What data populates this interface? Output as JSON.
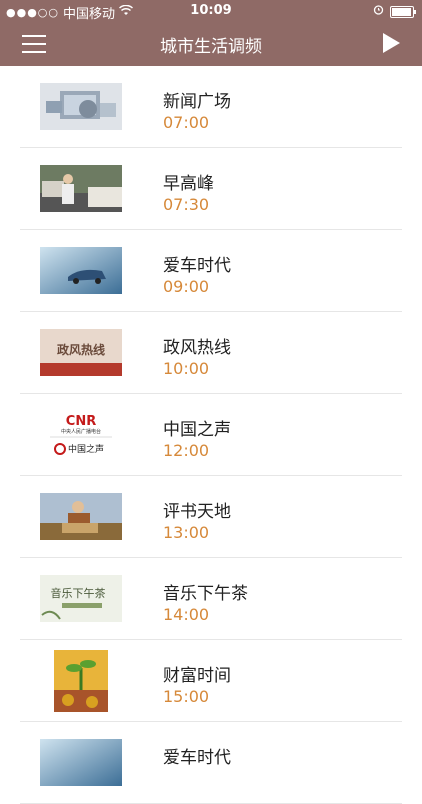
{
  "status": {
    "signal_dots": "●●●○○",
    "carrier": "中国移动",
    "time": "10:09"
  },
  "header": {
    "title": "城市生活调频"
  },
  "programs": [
    {
      "title": "新闻广场",
      "time": "07:00"
    },
    {
      "title": "早高峰",
      "time": "07:30"
    },
    {
      "title": "爱车时代",
      "time": "09:00"
    },
    {
      "title": "政风热线",
      "time": "10:00"
    },
    {
      "title": "中国之声",
      "time": "12:00"
    },
    {
      "title": "评书天地",
      "time": "13:00"
    },
    {
      "title": "音乐下午茶",
      "time": "14:00"
    },
    {
      "title": "财富时间",
      "time": "15:00"
    },
    {
      "title": "爱车时代",
      "time": ""
    }
  ],
  "thumbs": {
    "cnr_logo": "CNR",
    "cnr_sub": "中央人民广播电台",
    "cnr_name": "中国之声",
    "zhengfeng_text": "政风热线",
    "music_text": "音乐下午茶"
  },
  "colors": {
    "header_bg": "#8f6a66",
    "time_accent": "#d6893a"
  }
}
